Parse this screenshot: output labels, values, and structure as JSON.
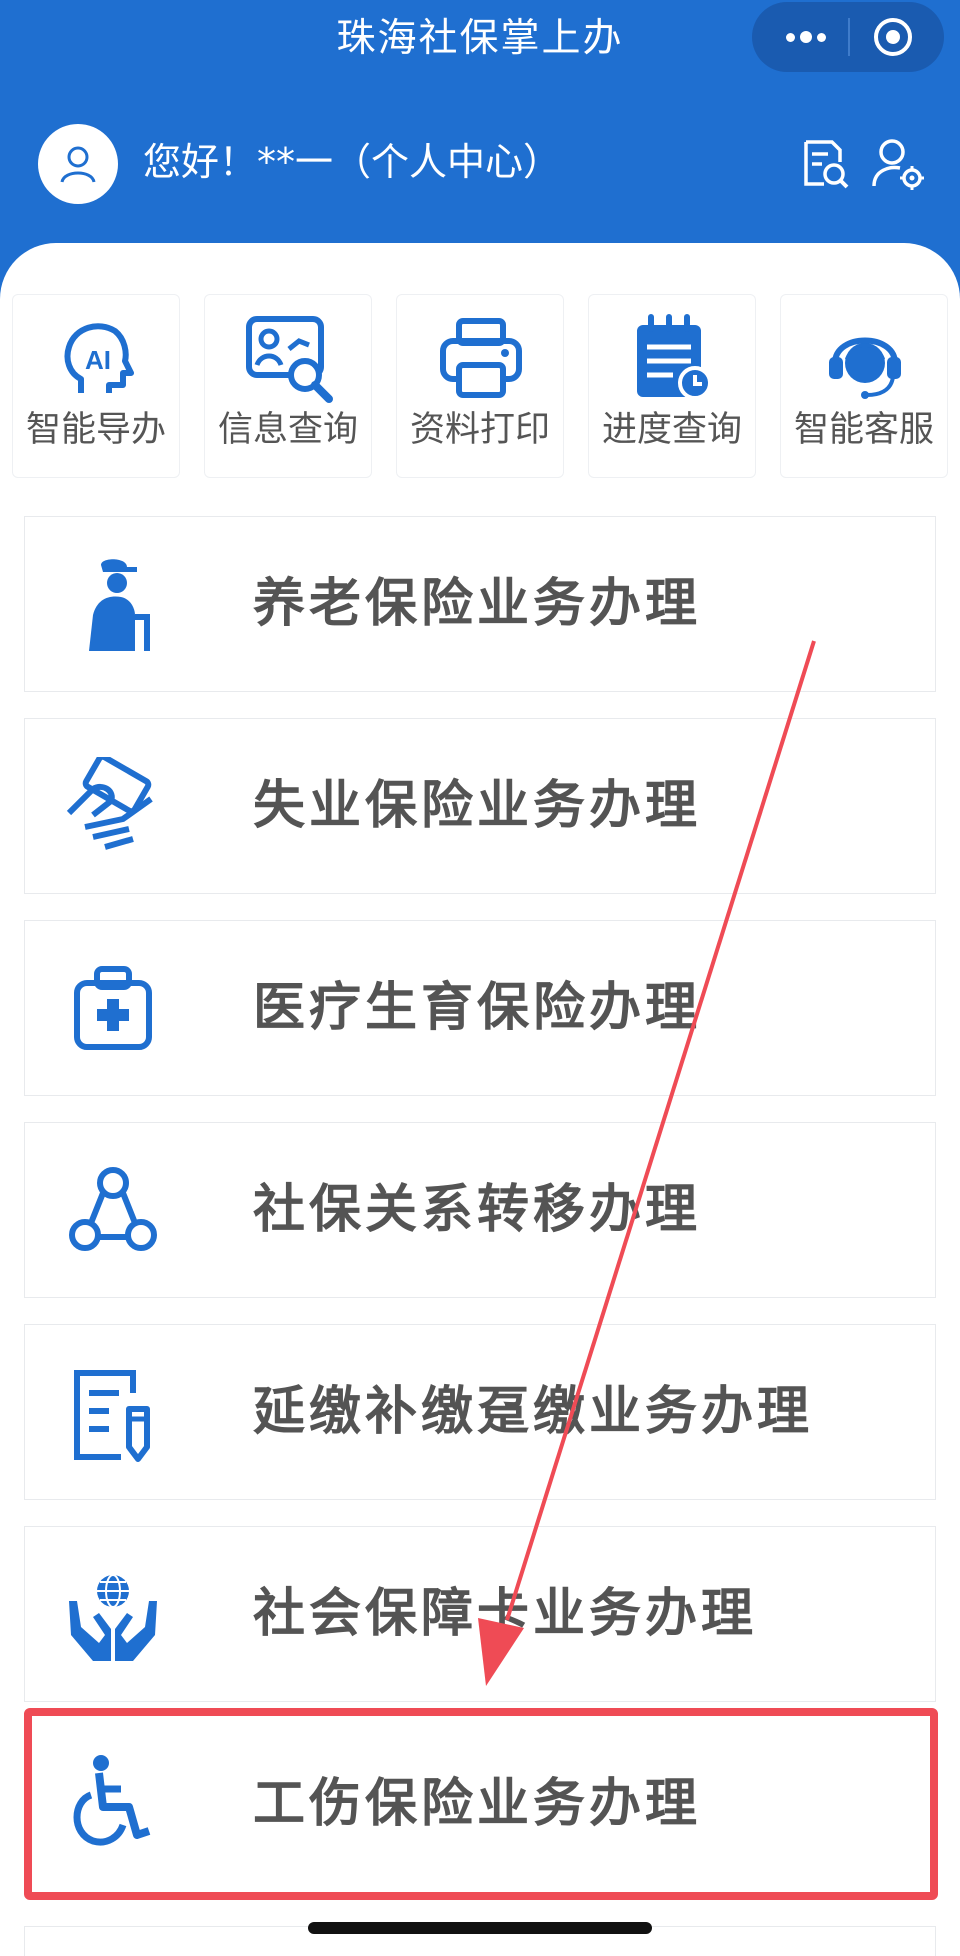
{
  "header": {
    "title": "珠海社保掌上办",
    "greeting": "您好！**一（个人中心）",
    "icons": [
      "search-document-icon",
      "user-settings-icon"
    ],
    "capsule_icons": [
      "more-icon",
      "target-icon"
    ]
  },
  "quick_actions": [
    {
      "label": "智能导办",
      "icon": "ai-head-icon"
    },
    {
      "label": "信息查询",
      "icon": "info-search-icon"
    },
    {
      "label": "资料打印",
      "icon": "printer-icon"
    },
    {
      "label": "进度查询",
      "icon": "progress-calendar-icon"
    },
    {
      "label": "智能客服",
      "icon": "customer-service-icon"
    }
  ],
  "services": [
    {
      "label": "养老保险业务办理",
      "icon": "elderly-person-icon"
    },
    {
      "label": "失业保险业务办理",
      "icon": "hand-card-icon"
    },
    {
      "label": "医疗生育保险办理",
      "icon": "medical-kit-icon"
    },
    {
      "label": "社保关系转移办理",
      "icon": "network-transfer-icon"
    },
    {
      "label": "延缴补缴趸缴业务办理",
      "icon": "document-pen-icon"
    },
    {
      "label": "社会保障卡业务办理",
      "icon": "globe-hands-icon"
    },
    {
      "label": "工伤保险业务办理",
      "icon": "wheelchair-icon"
    }
  ],
  "highlighted_service": "工伤保险业务办理",
  "colors": {
    "header_blue": "#1f6fd0",
    "icon_blue": "#1f6fd0",
    "highlight_red": "#ef4b55",
    "label_gray": "#545454"
  }
}
